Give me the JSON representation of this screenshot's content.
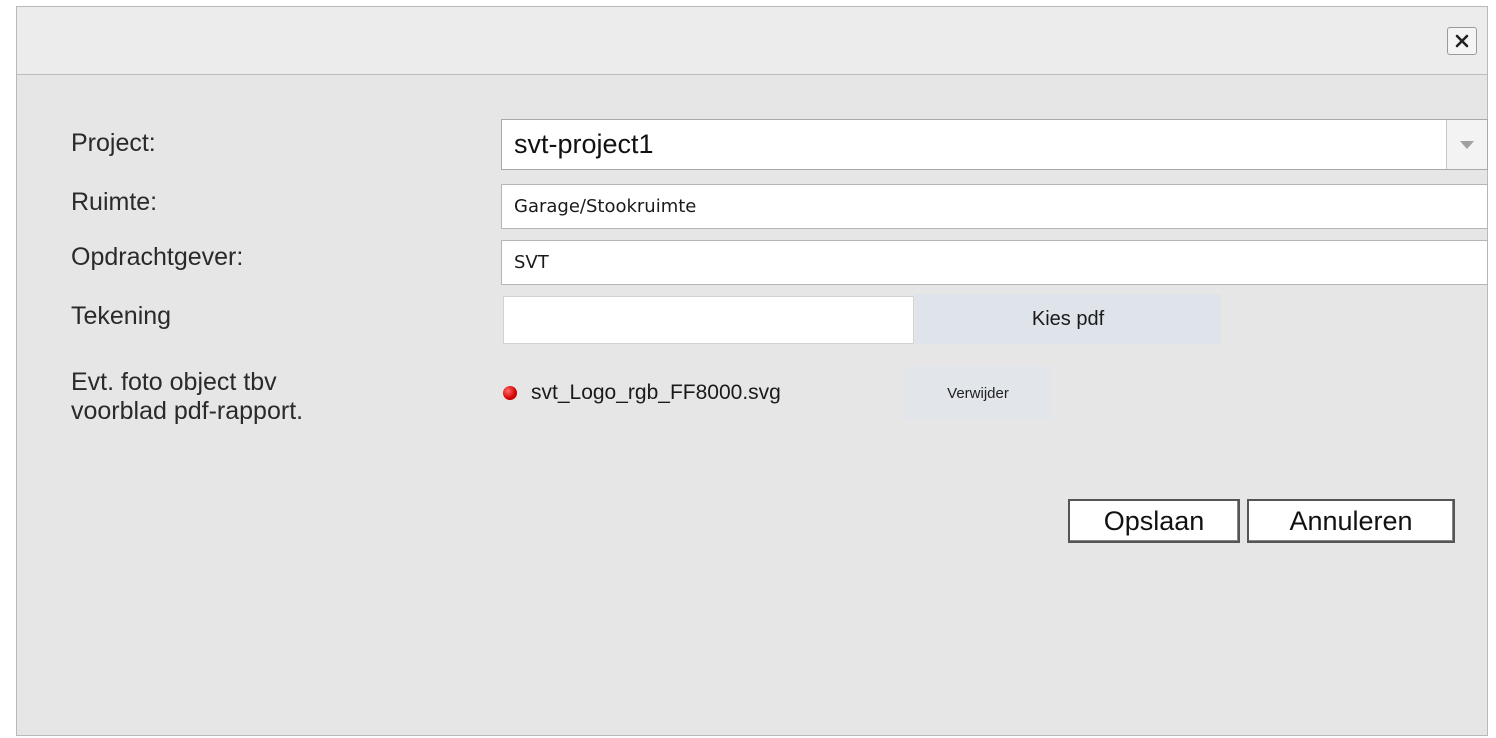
{
  "dialog": {
    "close_icon": "close-icon"
  },
  "form": {
    "project": {
      "label": "Project:",
      "value": "svt-project1"
    },
    "ruimte": {
      "label": "Ruimte:",
      "value": "Garage/Stookruimte"
    },
    "opdrachtgever": {
      "label": "Opdrachtgever:",
      "value": "SVT"
    },
    "tekening": {
      "label": "Tekening",
      "value": "",
      "button_label": "Kies pdf"
    },
    "foto": {
      "label_line1": "Evt. foto object tbv",
      "label_line2": "voorblad pdf-rapport.",
      "file_name": "svt_Logo_rgb_FF8000.svg",
      "remove_label": "Verwijder",
      "status_color": "#d40000"
    }
  },
  "actions": {
    "save_label": "Opslaan",
    "cancel_label": "Annuleren"
  }
}
